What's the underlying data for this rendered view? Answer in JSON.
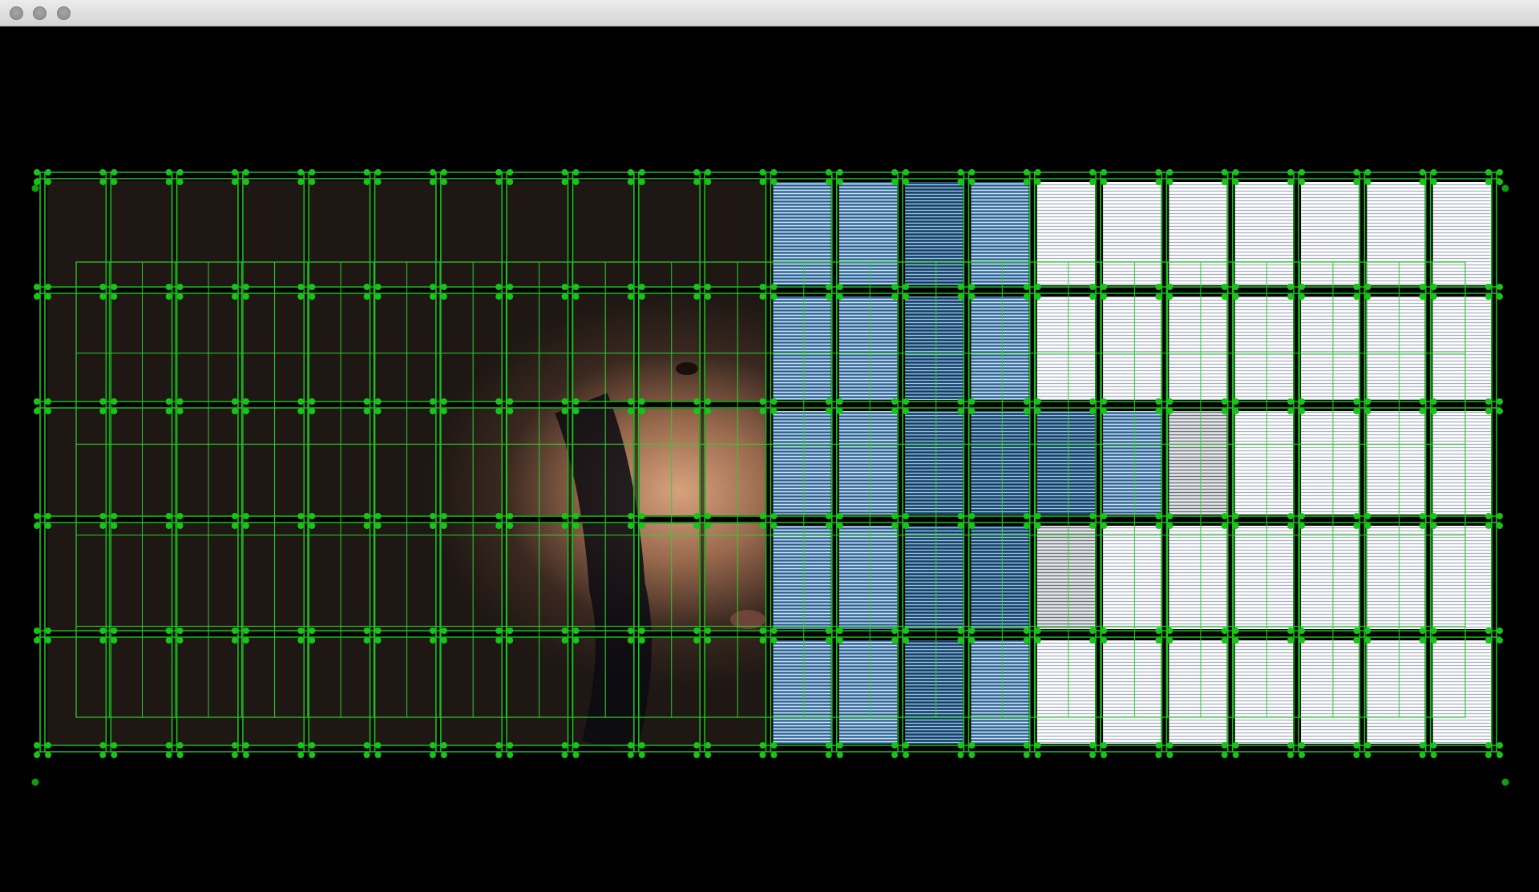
{
  "window": {
    "title": "",
    "buttons": [
      "close",
      "minimize",
      "zoom"
    ]
  },
  "projection": {
    "grid_columns": 22,
    "grid_rows": 5,
    "colors": {
      "background": "#000000",
      "grid_line": "#1fbf1f",
      "handle": "#17c417",
      "inner_grid": "#2bd42b"
    },
    "left_content": "webcam-face",
    "right_content": "striped-blue-white-cells"
  }
}
